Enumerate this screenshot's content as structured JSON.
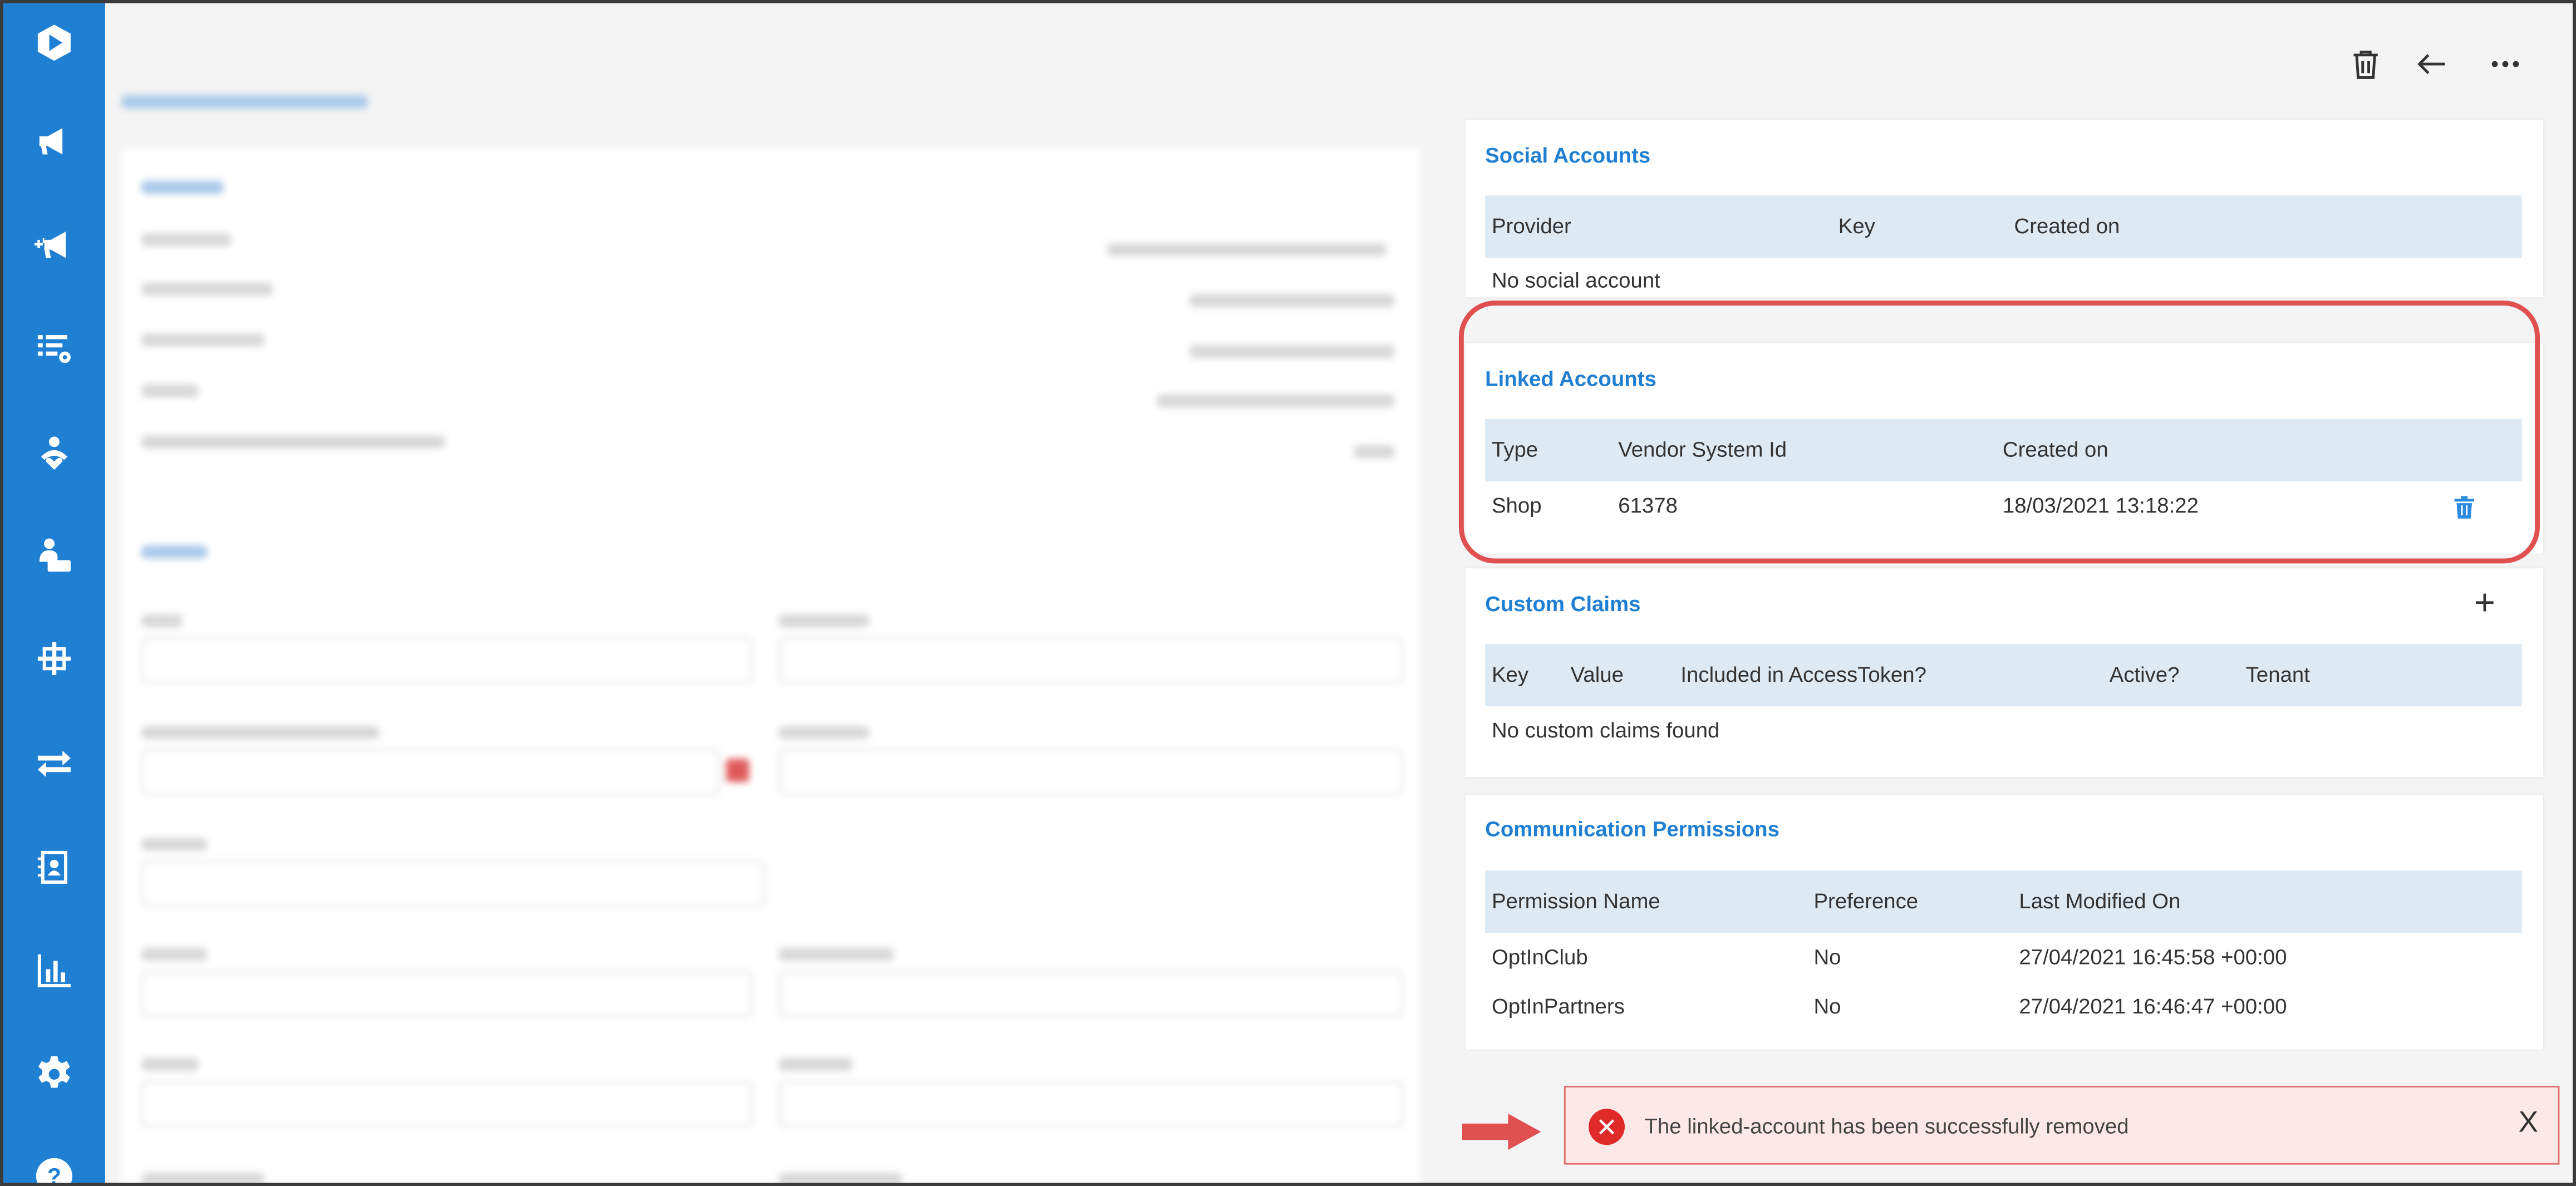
{
  "social": {
    "title": "Social Accounts",
    "headers": [
      "Provider",
      "Key",
      "Created on"
    ],
    "empty": "No social account"
  },
  "linked": {
    "title": "Linked Accounts",
    "headers": [
      "Type",
      "Vendor System Id",
      "Created on"
    ],
    "row": {
      "type": "Shop",
      "vendor_id": "61378",
      "created": "18/03/2021 13:18:22"
    }
  },
  "claims": {
    "title": "Custom Claims",
    "add": "+",
    "headers": [
      "Key",
      "Value",
      "Included in AccessToken?",
      "Active?",
      "Tenant"
    ],
    "empty": "No custom claims found"
  },
  "permissions": {
    "title": "Communication Permissions",
    "headers": [
      "Permission Name",
      "Preference",
      "Last Modified On"
    ],
    "rows": [
      {
        "name": "OptInClub",
        "pref": "No",
        "modified": "27/04/2021 16:45:58 +00:00"
      },
      {
        "name": "OptInPartners",
        "pref": "No",
        "modified": "27/04/2021 16:46:47 +00:00"
      }
    ]
  },
  "toast": {
    "message": "The linked-account has been successfully removed",
    "close": "X"
  },
  "colors": {
    "accent": "#1f7fd3",
    "highlight": "#e05050",
    "error": "#e02a2a",
    "toast_bg": "#fde8e8"
  },
  "sidebar_icons": [
    "logo-icon",
    "megaphone-icon",
    "megaphone-plus-icon",
    "list-settings-icon",
    "user-heart-icon",
    "user-laptop-icon",
    "network-icon",
    "transfer-icon",
    "contacts-icon",
    "chart-icon",
    "gear-icon",
    "help-icon"
  ]
}
